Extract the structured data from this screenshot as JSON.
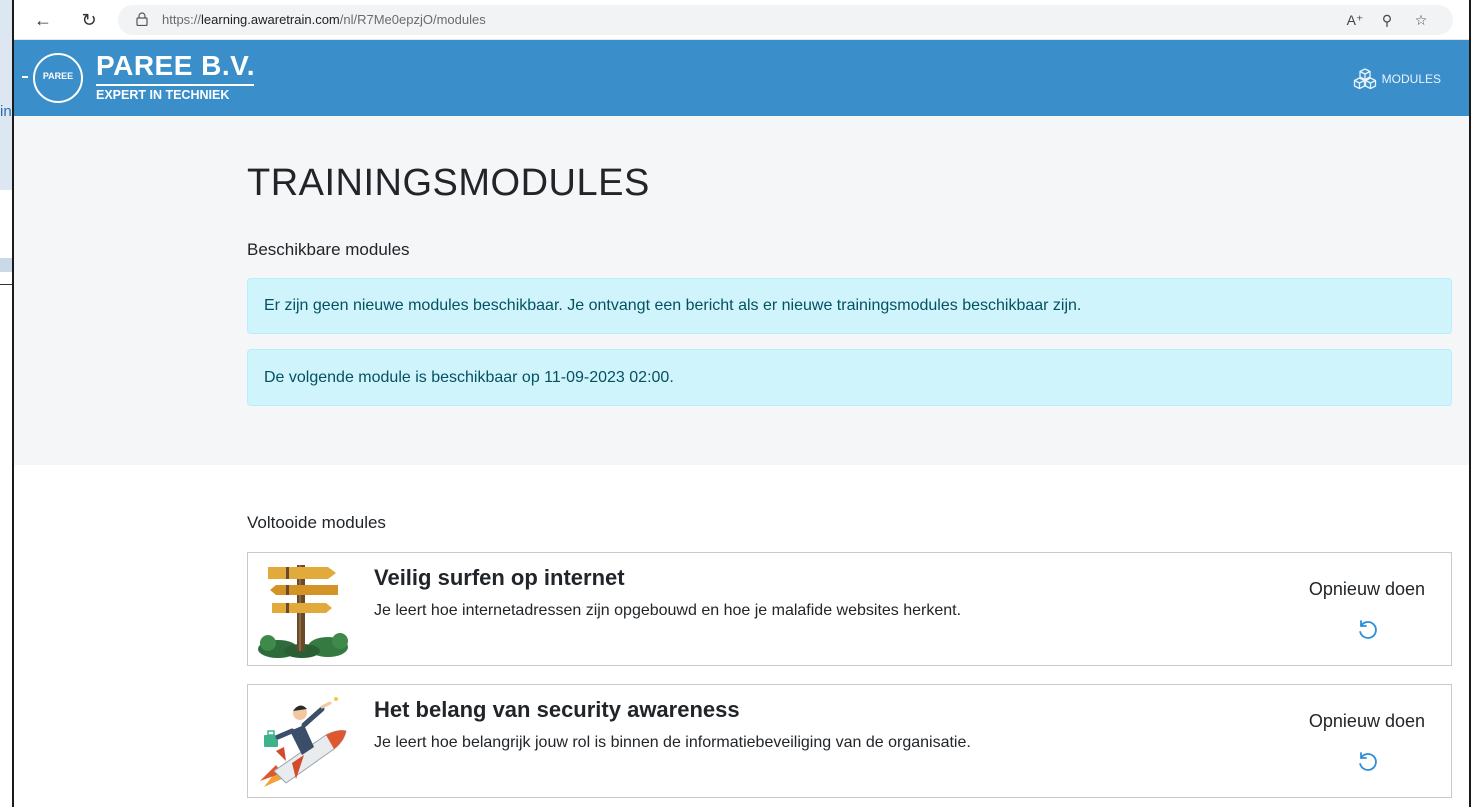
{
  "browser": {
    "url_prefix": "https://",
    "url_host": "learning.awaretrain.com",
    "url_path": "/nl/R7Me0epzjO/modules",
    "icons": [
      "back-arrow-icon",
      "reload-icon",
      "lock-icon",
      "read-aloud-icon",
      "zoom-icon",
      "favorites-icon"
    ]
  },
  "peek": {
    "char": "in"
  },
  "header": {
    "logo_circle_text": "PAREE",
    "brand_name": "PAREE B.V.",
    "brand_tagline": "EXPERT IN TECHNIEK",
    "nav_modules_label": "MODULES",
    "colors": {
      "header_bg": "#3a8fcb"
    }
  },
  "main": {
    "title": "TRAININGSMODULES",
    "available_label": "Beschikbare modules",
    "alerts": [
      "Er zijn geen nieuwe modules beschikbaar. Je ontvangt een bericht als er nieuwe trainingsmodules beschikbaar zijn.",
      "De volgende module is beschikbaar op 11-09-2023 02:00."
    ],
    "completed_label": "Voltooide modules",
    "modules": [
      {
        "title": "Veilig surfen op internet",
        "description": "Je leert hoe internetadressen zijn opgebouwd en hoe je malafide websites herkent.",
        "action_label": "Opnieuw doen",
        "image": "signpost-illustration"
      },
      {
        "title": "Het belang van security awareness",
        "description": "Je leert hoe belangrijk jouw rol is binnen de informatiebeveiliging van de organisatie.",
        "action_label": "Opnieuw doen",
        "image": "businessman-rocket-illustration"
      }
    ],
    "colors": {
      "alert_bg": "#cff4fc",
      "alert_text": "#055160",
      "redo_icon": "#2f8fd8"
    }
  }
}
